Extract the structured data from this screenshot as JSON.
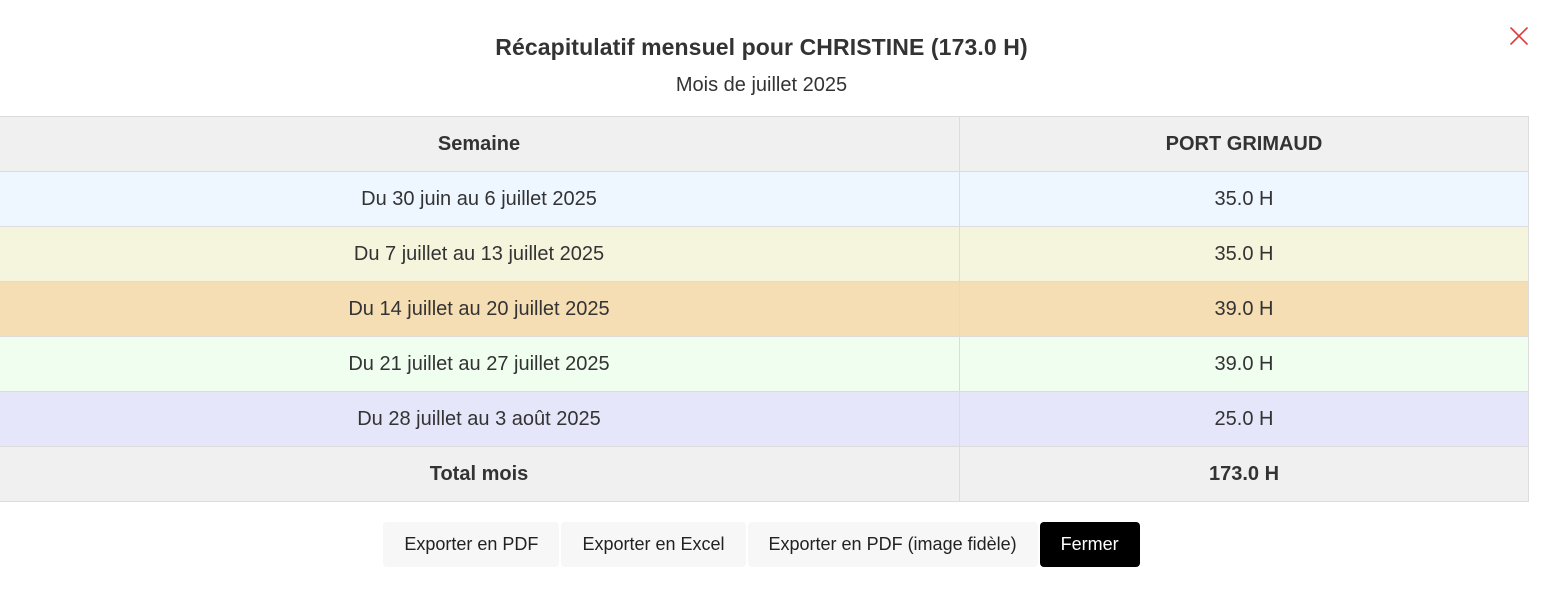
{
  "modal": {
    "title": "Récapitulatif mensuel pour CHRISTINE (173.0 H)",
    "subtitle": "Mois de juillet 2025",
    "close_icon": "close-icon",
    "close_color": "#e03b3b"
  },
  "table": {
    "headers": [
      "Semaine",
      "PORT GRIMAUD"
    ],
    "rows": [
      {
        "week": "Du 30 juin au 6 juillet 2025",
        "hours": "35.0 H",
        "color": "#eef6ff"
      },
      {
        "week": "Du 7 juillet au 13 juillet 2025",
        "hours": "35.0 H",
        "color": "#f5f4dc"
      },
      {
        "week": "Du 14 juillet au 20 juillet 2025",
        "hours": "39.0 H",
        "color": "#f5deb3"
      },
      {
        "week": "Du 21 juillet au 27 juillet 2025",
        "hours": "39.0 H",
        "color": "#effeef"
      },
      {
        "week": "Du 28 juillet au 3 août 2025",
        "hours": "25.0 H",
        "color": "#e6e6fa"
      }
    ],
    "total": {
      "label": "Total mois",
      "hours": "173.0 H"
    }
  },
  "actions": {
    "export_pdf": "Exporter en PDF",
    "export_excel": "Exporter en Excel",
    "export_pdf_image": "Exporter en PDF (image fidèle)",
    "close": "Fermer"
  }
}
